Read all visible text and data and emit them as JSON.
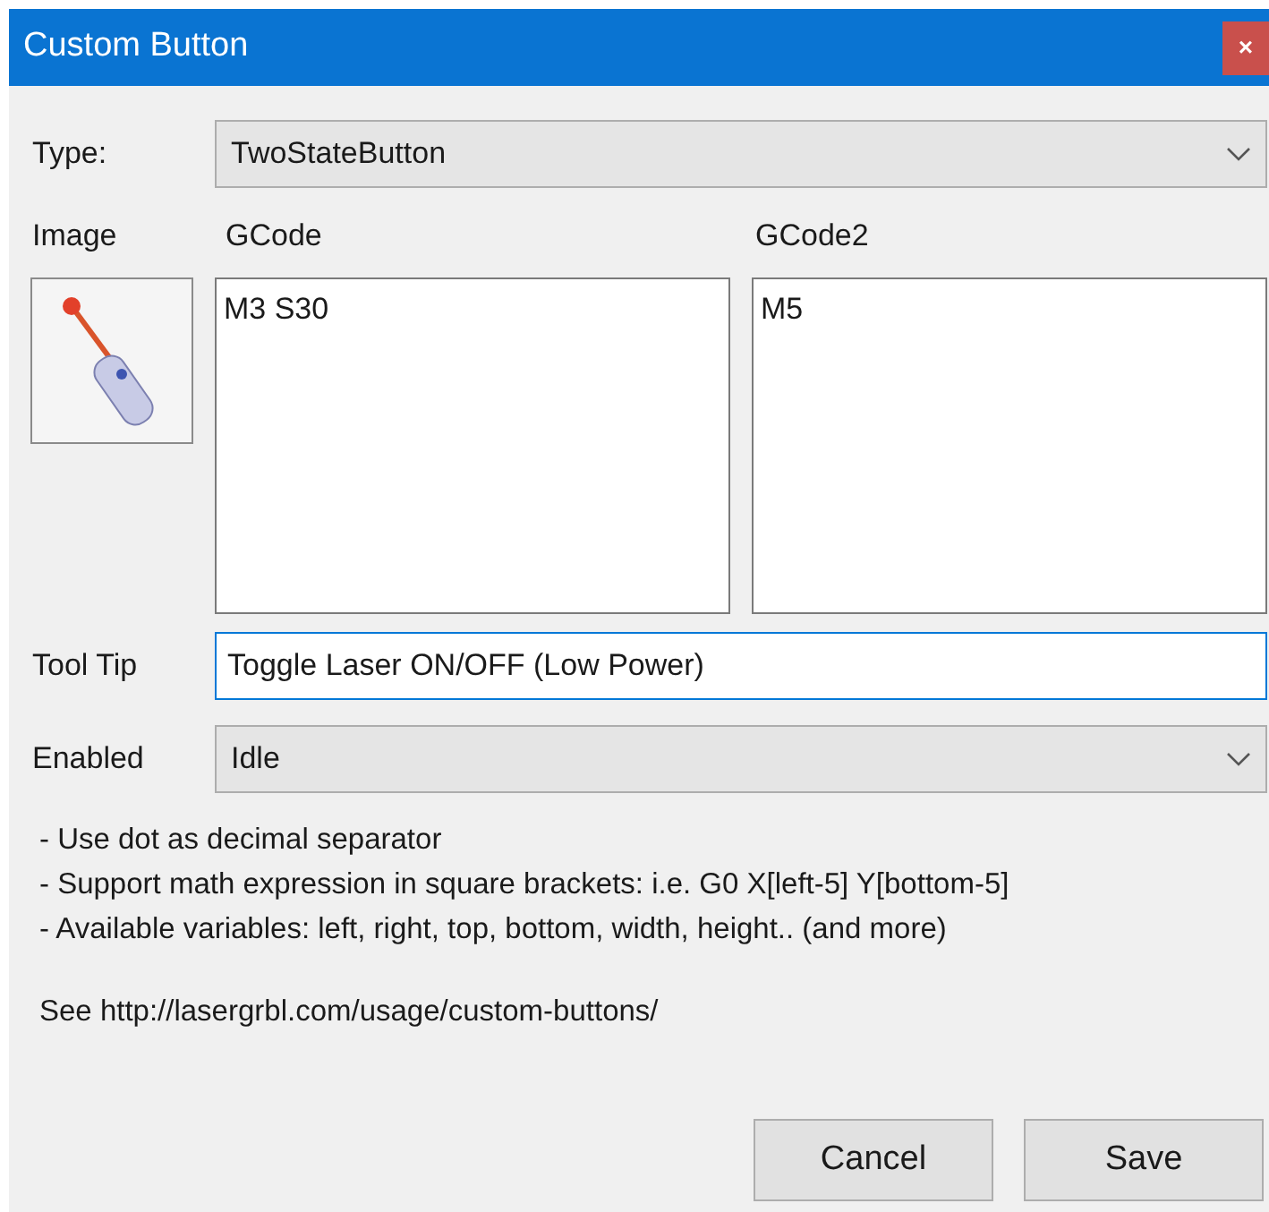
{
  "window": {
    "title": "Custom Button",
    "close": "×"
  },
  "type": {
    "label": "Type:",
    "value": "TwoStateButton"
  },
  "image": {
    "label": "Image"
  },
  "gcode": {
    "label": "GCode",
    "value": "M3 S30"
  },
  "gcode2": {
    "label": "GCode2",
    "value": "M5"
  },
  "tooltip": {
    "label": "Tool Tip",
    "value": "Toggle Laser ON/OFF (Low Power)"
  },
  "enabled": {
    "label": "Enabled",
    "value": "Idle"
  },
  "notes": [
    "- Use dot as decimal separator",
    "- Support math expression in square brackets: i.e. G0 X[left-5] Y[bottom-5]",
    "- Available variables: left, right, top, bottom, width, height.. (and more)"
  ],
  "see": "See http://lasergrbl.com/usage/custom-buttons/",
  "buttons": [
    "Cancel",
    "Save"
  ]
}
